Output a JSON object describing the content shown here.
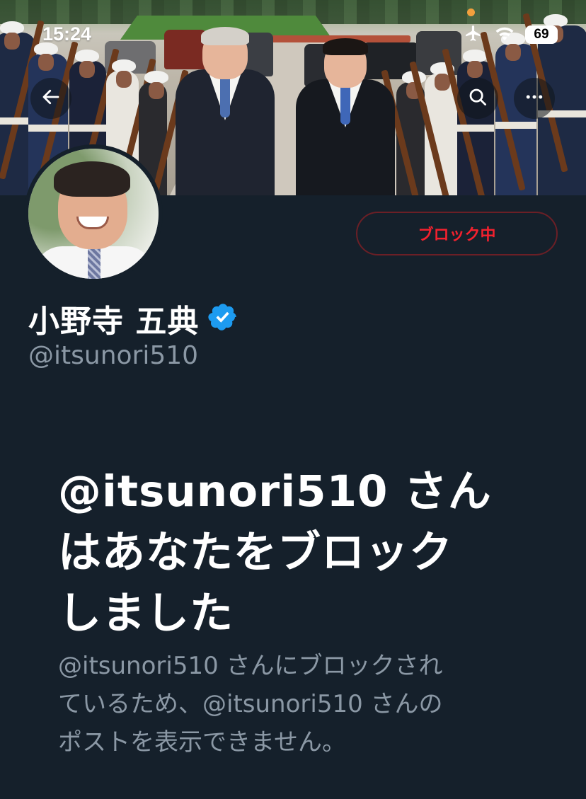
{
  "status_bar": {
    "time": "15:24",
    "battery": "69",
    "icons": [
      "airplane-icon",
      "wifi-icon",
      "battery-icon"
    ]
  },
  "header": {
    "back_icon": "arrow-left-icon",
    "search_icon": "search-icon",
    "more_icon": "more-horizontal-icon"
  },
  "profile": {
    "display_name": "小野寺 五典",
    "verified": true,
    "handle": "@itsunori510",
    "block_button_label": "ブロック中"
  },
  "blocked_notice": {
    "title_line1": "@itsunori510 さん",
    "title_line2": "はあなたをブロック",
    "title_line3": "しました",
    "desc_line1": "@itsunori510 さんにブロックされ",
    "desc_line2": "ているため、@itsunori510 さんの",
    "desc_line3": "ポストを表示できません。"
  },
  "colors": {
    "background": "#15202b",
    "block_red": "#f4212e",
    "verified_blue": "#1d9bf0",
    "secondary_text": "#8b98a5"
  }
}
